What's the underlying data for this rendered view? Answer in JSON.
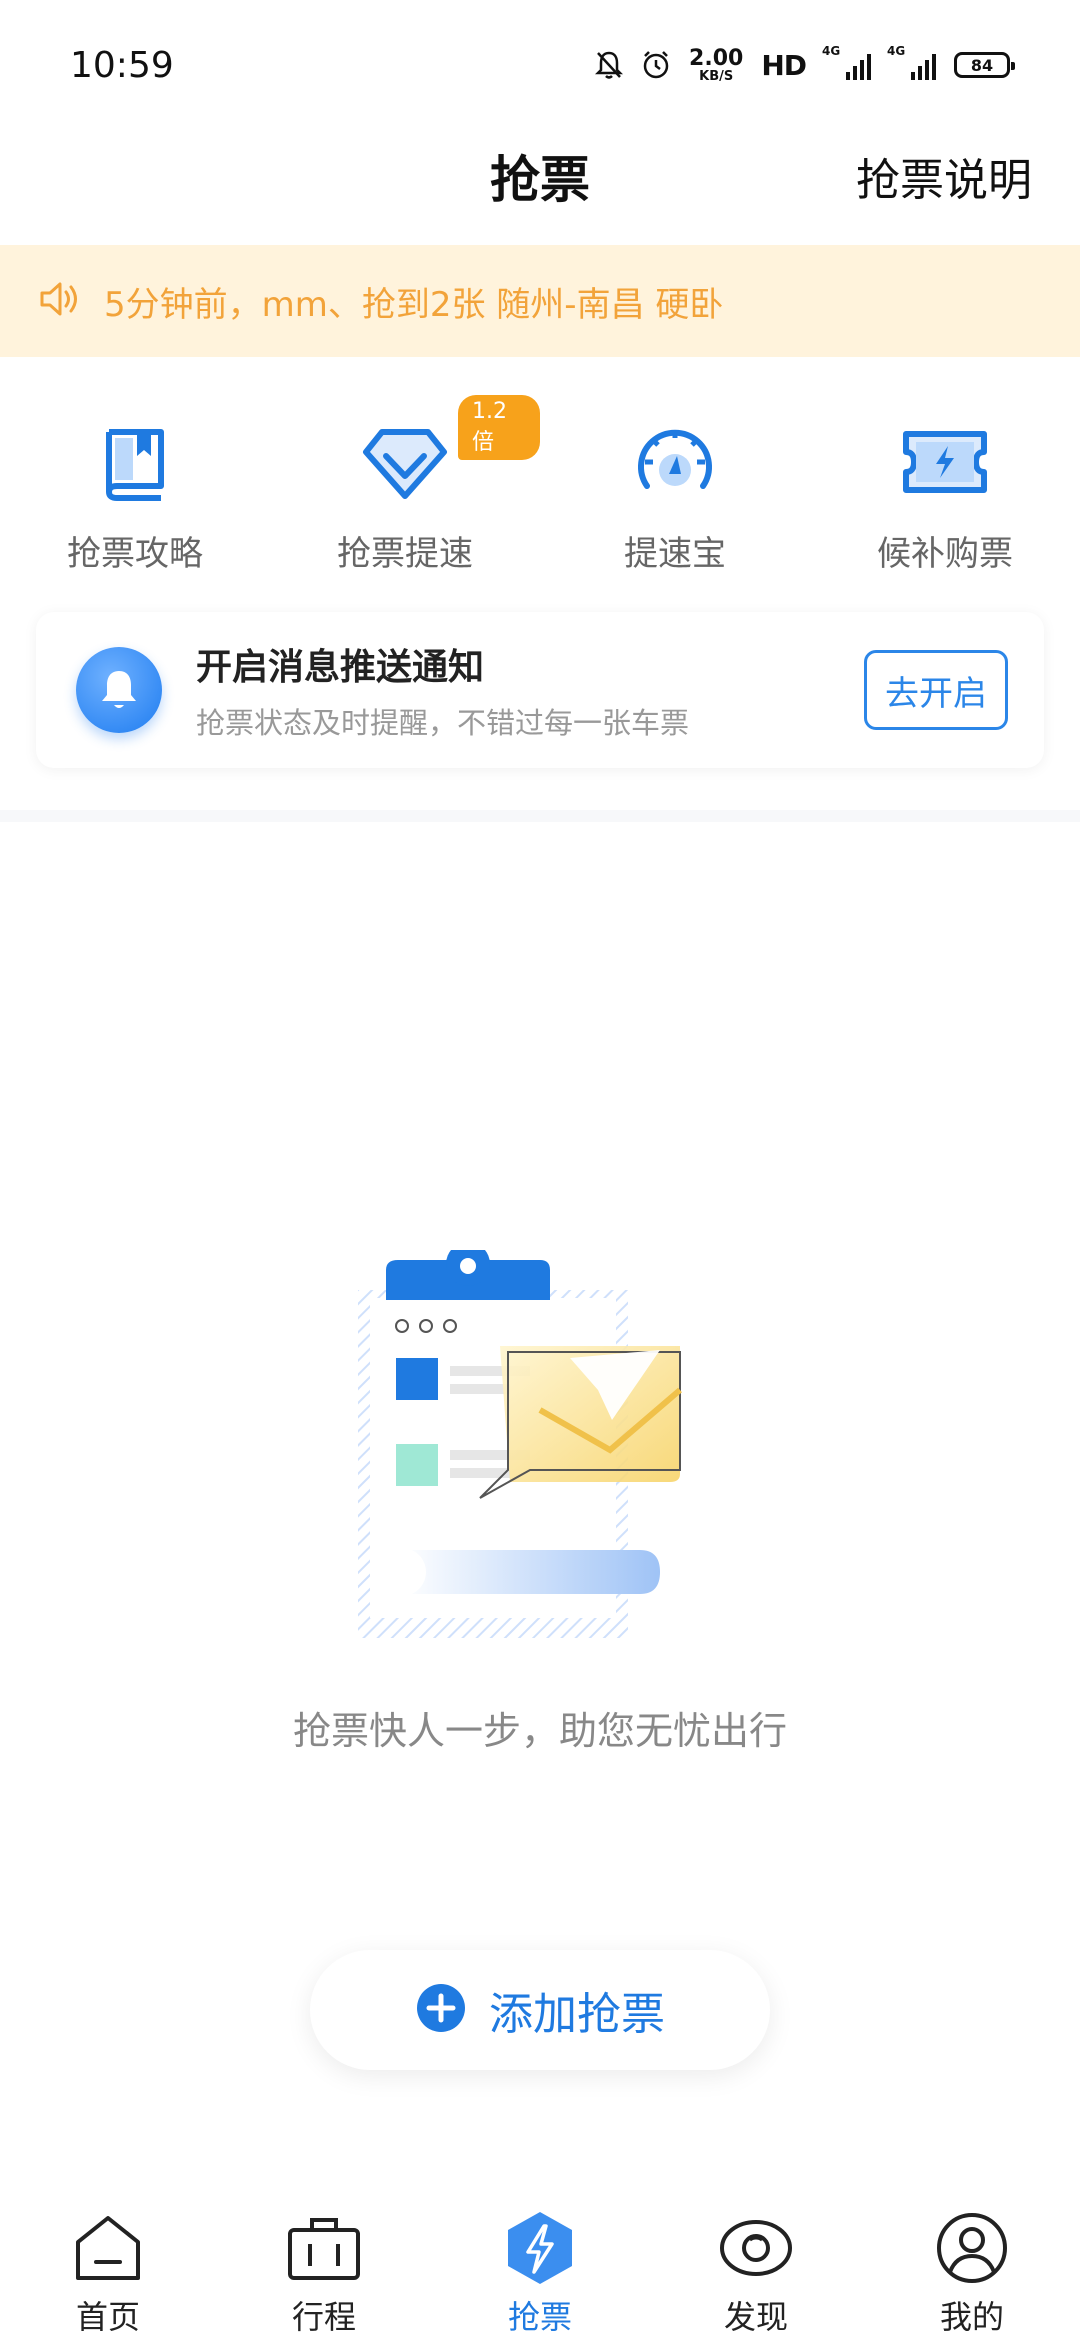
{
  "status_bar": {
    "time": "10:59",
    "speed_value": "2.00",
    "speed_unit": "KB/S",
    "hd": "HD",
    "net1": "4G",
    "net2": "4G",
    "battery": "84"
  },
  "nav": {
    "title": "抢票",
    "right_link": "抢票说明"
  },
  "notice": {
    "text": "5分钟前，mm、抢到2张 随州-南昌 硬卧",
    "color": "#f2a33a"
  },
  "entries": [
    {
      "label": "抢票攻略",
      "icon": "book-icon"
    },
    {
      "label": "抢票提速",
      "icon": "diamond-icon",
      "badge": "1.2倍"
    },
    {
      "label": "提速宝",
      "icon": "speedometer-icon"
    },
    {
      "label": "候补购票",
      "icon": "ticket-icon"
    }
  ],
  "push_card": {
    "title": "开启消息推送通知",
    "subtitle": "抢票状态及时提醒，不错过每一张车票",
    "button": "去开启"
  },
  "empty_state": {
    "text": "抢票快人一步，助您无忧出行"
  },
  "add_button": {
    "label": "添加抢票"
  },
  "tabbar": [
    {
      "label": "首页",
      "icon": "home-icon",
      "active": false
    },
    {
      "label": "行程",
      "icon": "suitcase-icon",
      "active": false
    },
    {
      "label": "抢票",
      "icon": "lightning-icon",
      "active": true
    },
    {
      "label": "发现",
      "icon": "eye-icon",
      "active": false
    },
    {
      "label": "我的",
      "icon": "user-icon",
      "active": false
    }
  ],
  "colors": {
    "accent": "#1f7ae0",
    "badge": "#f7a21b",
    "notice_bg": "#fff3dc"
  }
}
